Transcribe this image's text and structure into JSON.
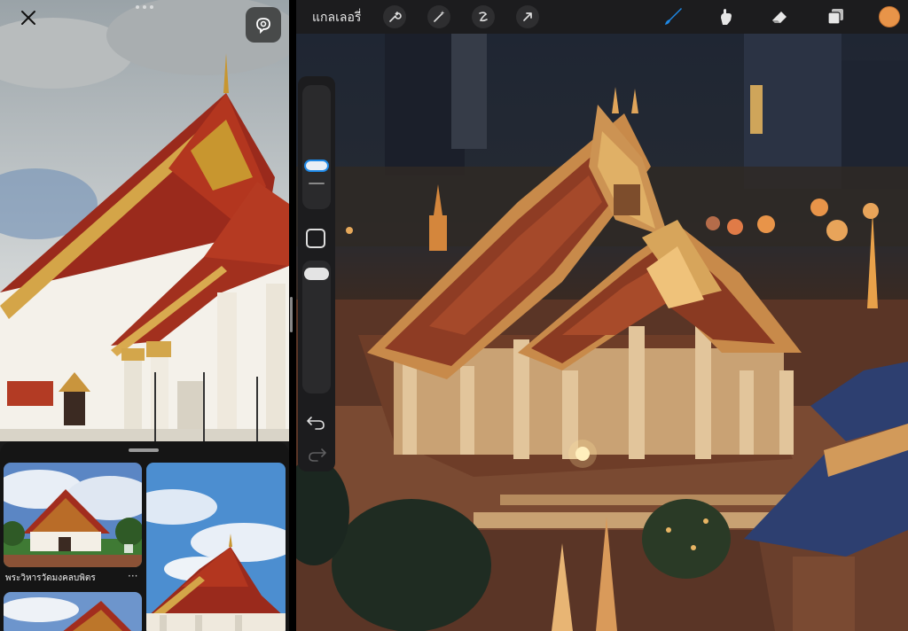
{
  "left_pane": {
    "close_icon": "close-icon",
    "lens_icon": "visual-lookup-icon",
    "results": [
      {
        "title": "พระวิหารวัดมงคลบพิตร",
        "more_label": "···"
      }
    ]
  },
  "procreate": {
    "gallery_label": "แกลเลอรี่",
    "left_tools": [
      "wrench-icon",
      "magic-wand-icon",
      "selection-icon",
      "transform-arrow-icon"
    ],
    "right_tools": [
      "brush-icon",
      "smudge-icon",
      "eraser-icon",
      "layers-icon"
    ],
    "active_tool": "brush-icon",
    "current_color": "#e89449",
    "accent_color": "#1e88e5"
  }
}
